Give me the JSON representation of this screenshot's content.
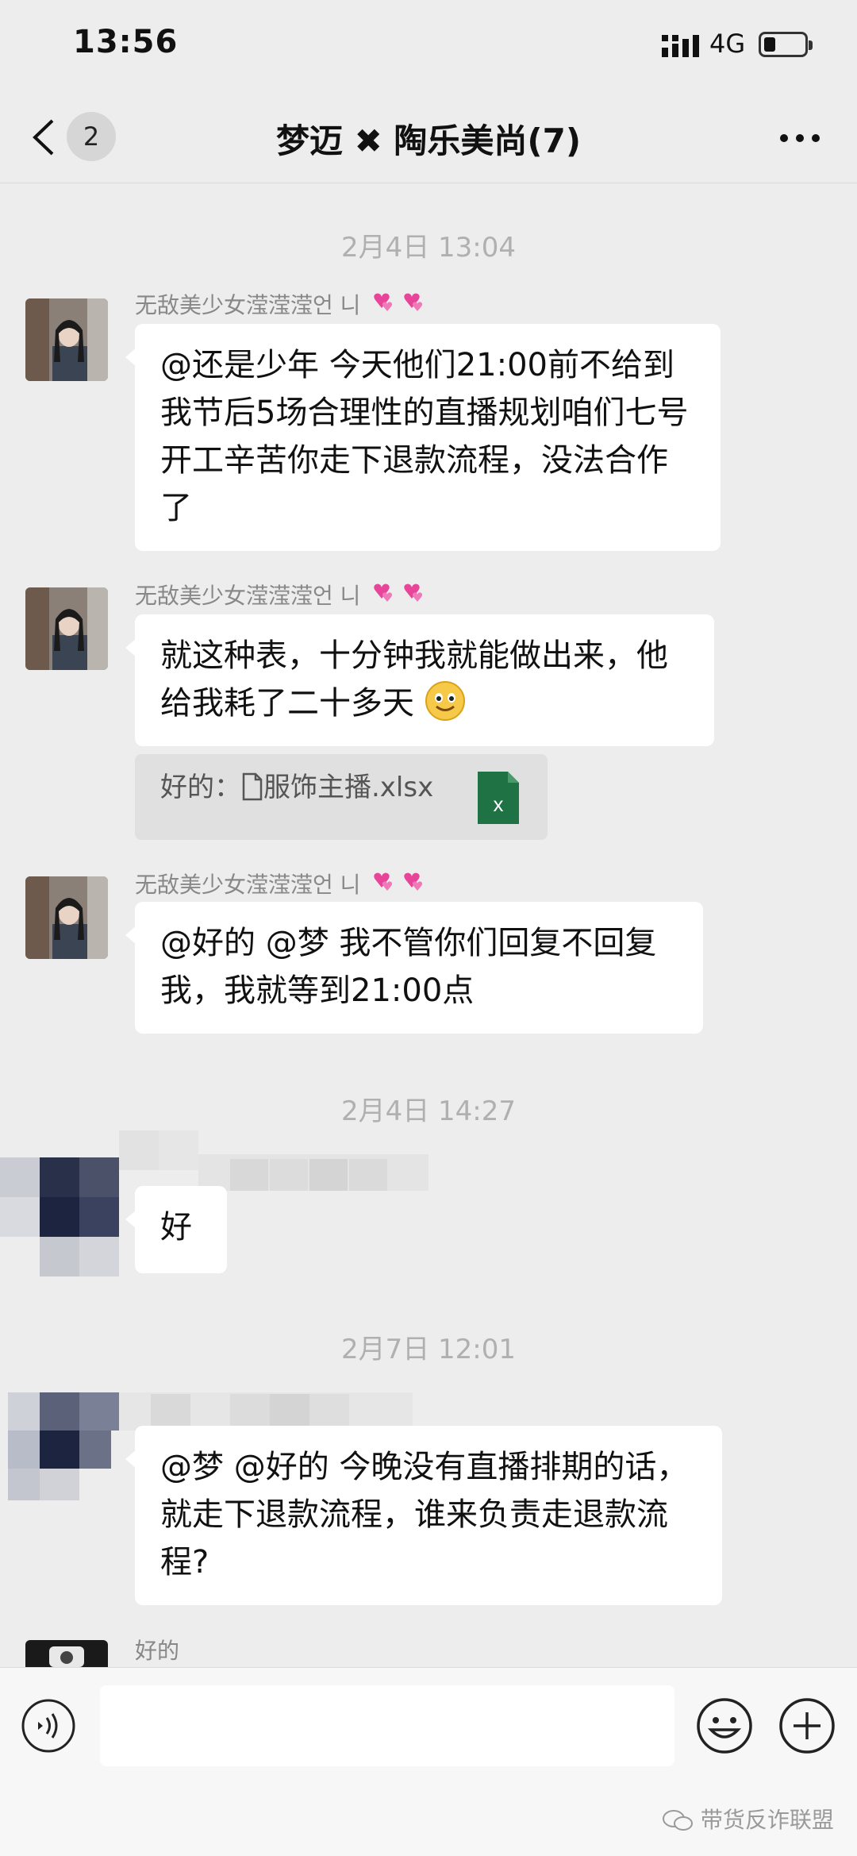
{
  "status_bar": {
    "time": "13:56",
    "network": "4G"
  },
  "nav": {
    "unread_count": "2",
    "title": "梦迈 ✖ 陶乐美尚(7)"
  },
  "messages": [
    {
      "time": "2月4日 13:04"
    },
    {
      "sender": "无敌美少女滢滢滢언 니",
      "text": "@还是少年 今天他们21:00前不给到我节后5场合理性的直播规划咱们七号开工辛苦你走下退款流程，没法合作了"
    },
    {
      "sender": "无敌美少女滢滢滢언 니",
      "text": "就这种表，十分钟我就能做出来，他给我耗了二十多天",
      "quote": {
        "prefix": "好的：",
        "file": "服饰主播.xlsx"
      }
    },
    {
      "sender": "无敌美少女滢滢滢언 니",
      "text": "@好的 @梦 我不管你们回复不回复我，我就等到21:00点"
    },
    {
      "time": "2月4日 14:27"
    },
    {
      "text": "好"
    },
    {
      "time": "2月7日 12:01"
    },
    {
      "text": "@梦 @好的 今晚没有直播排期的话，就走下退款流程，谁来负责走退款流程?"
    },
    {
      "sender": "好的"
    }
  ],
  "input_bar": {
    "placeholder": ""
  },
  "watermark": "带货反诈联盟",
  "colors": {
    "background": "#ededed",
    "bubble": "#ffffff",
    "excel_green": "#1f7244",
    "heart_pink": "#e8449a"
  }
}
